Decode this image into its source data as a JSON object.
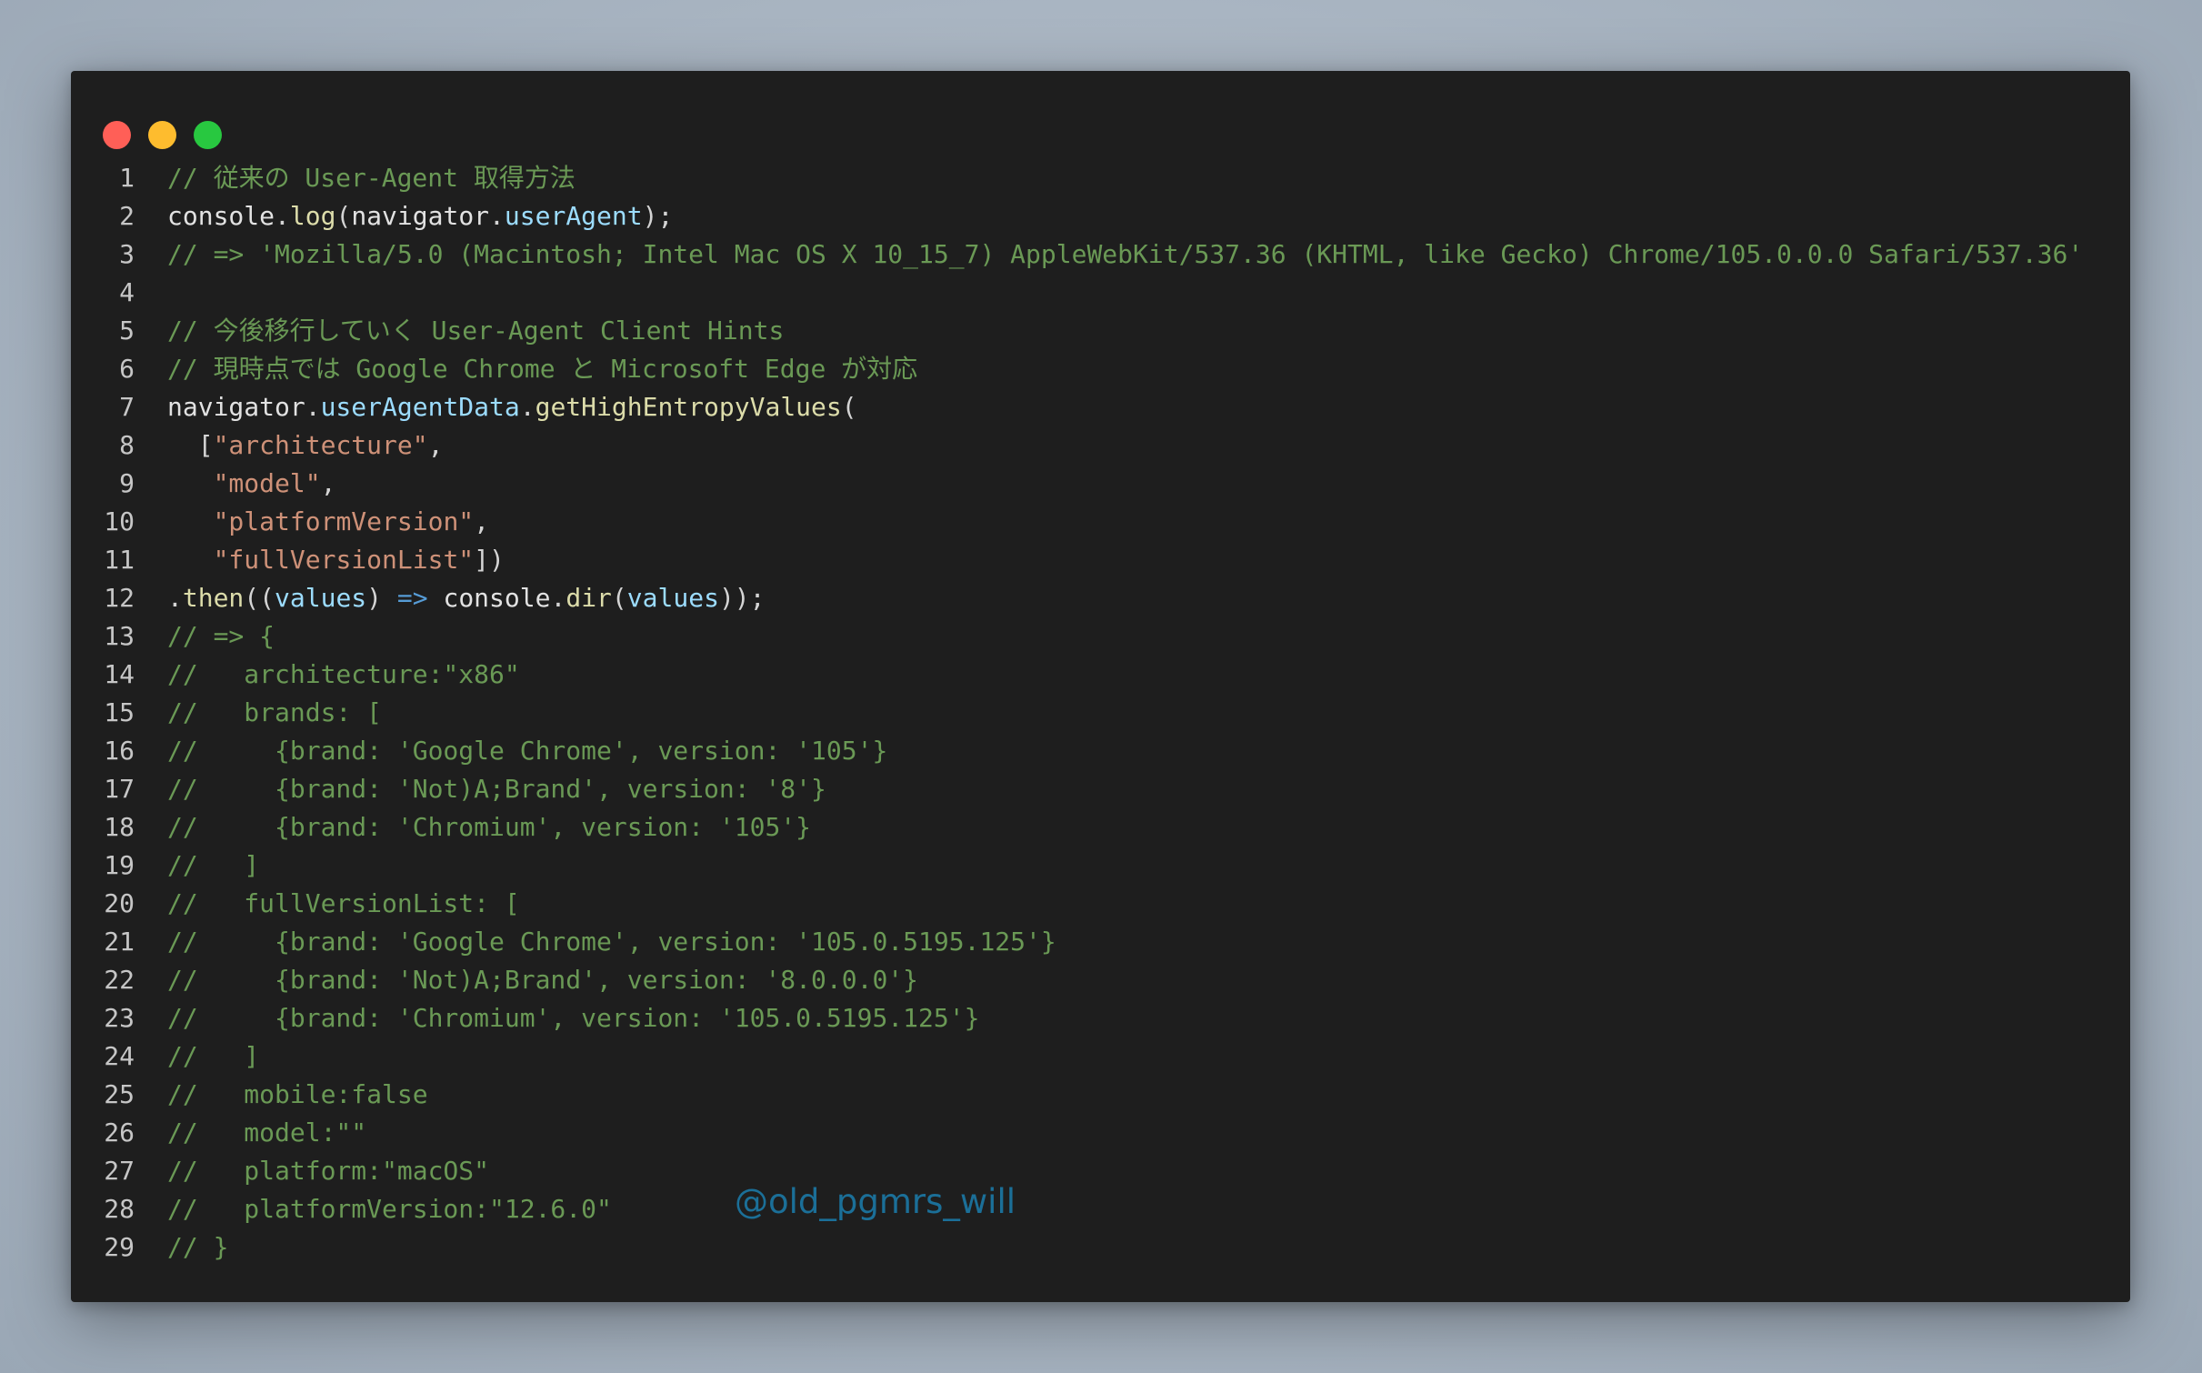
{
  "window": {
    "controls": {
      "close_color": "#ff5f57",
      "minimize_color": "#febc2e",
      "maximize_color": "#28c840"
    }
  },
  "editor": {
    "line_numbers": [
      "1",
      "2",
      "3",
      "4",
      "5",
      "6",
      "7",
      "8",
      "9",
      "10",
      "11",
      "12",
      "13",
      "14",
      "15",
      "16",
      "17",
      "18",
      "19",
      "20",
      "21",
      "22",
      "23",
      "24",
      "25",
      "26",
      "27",
      "28",
      "29"
    ],
    "tokens": {
      "l1_comment": "// 従来の User-Agent 取得方法",
      "l2_console": "console",
      "l2_dot1": ".",
      "l2_log": "log",
      "l2_paren_open": "(",
      "l2_navigator": "navigator",
      "l2_dot2": ".",
      "l2_userAgent": "userAgent",
      "l2_end": ");",
      "l3_comment": "// => 'Mozilla/5.0 (Macintosh; Intel Mac OS X 10_15_7) AppleWebKit/537.36 (KHTML, like Gecko) Chrome/105.0.0.0 Safari/537.36'",
      "l4_blank": "",
      "l5_comment": "// 今後移行していく User-Agent Client Hints",
      "l6_comment": "// 現時点では Google Chrome と Microsoft Edge が対応",
      "l7_navigator": "navigator",
      "l7_dot1": ".",
      "l7_userAgentData": "userAgentData",
      "l7_dot2": ".",
      "l7_method": "getHighEntropyValues",
      "l7_paren": "(",
      "l8_bracket": "  [",
      "l8_str": "\"architecture\"",
      "l8_comma": ",",
      "l9_indent": "   ",
      "l9_str": "\"model\"",
      "l9_comma": ",",
      "l10_indent": "   ",
      "l10_str": "\"platformVersion\"",
      "l10_comma": ",",
      "l11_indent": "   ",
      "l11_str": "\"fullVersionList\"",
      "l11_end": "])",
      "l12_dot": ".",
      "l12_then": "then",
      "l12_open": "((",
      "l12_values": "values",
      "l12_close": ") ",
      "l12_arrow": "=>",
      "l12_space": " ",
      "l12_console": "console",
      "l12_dot2": ".",
      "l12_dir": "dir",
      "l12_open2": "(",
      "l12_values2": "values",
      "l12_end": "));",
      "l13_comment": "// => {",
      "l14_comment": "//   architecture:\"x86\"",
      "l15_comment": "//   brands: [",
      "l16_comment": "//     {brand: 'Google Chrome', version: '105'}",
      "l17_comment": "//     {brand: 'Not)A;Brand', version: '8'}",
      "l18_comment": "//     {brand: 'Chromium', version: '105'}",
      "l19_comment": "//   ]",
      "l20_comment": "//   fullVersionList: [",
      "l21_comment": "//     {brand: 'Google Chrome', version: '105.0.5195.125'}",
      "l22_comment": "//     {brand: 'Not)A;Brand', version: '8.0.0.0'}",
      "l23_comment": "//     {brand: 'Chromium', version: '105.0.5195.125'}",
      "l24_comment": "//   ]",
      "l25_comment": "//   mobile:false",
      "l26_comment": "//   model:\"\"",
      "l27_comment": "//   platform:\"macOS\"",
      "l28_comment": "//   platformVersion:\"12.6.0\"",
      "l29_comment": "// }"
    }
  },
  "watermark": {
    "text": "@old_pgmrs_will"
  }
}
